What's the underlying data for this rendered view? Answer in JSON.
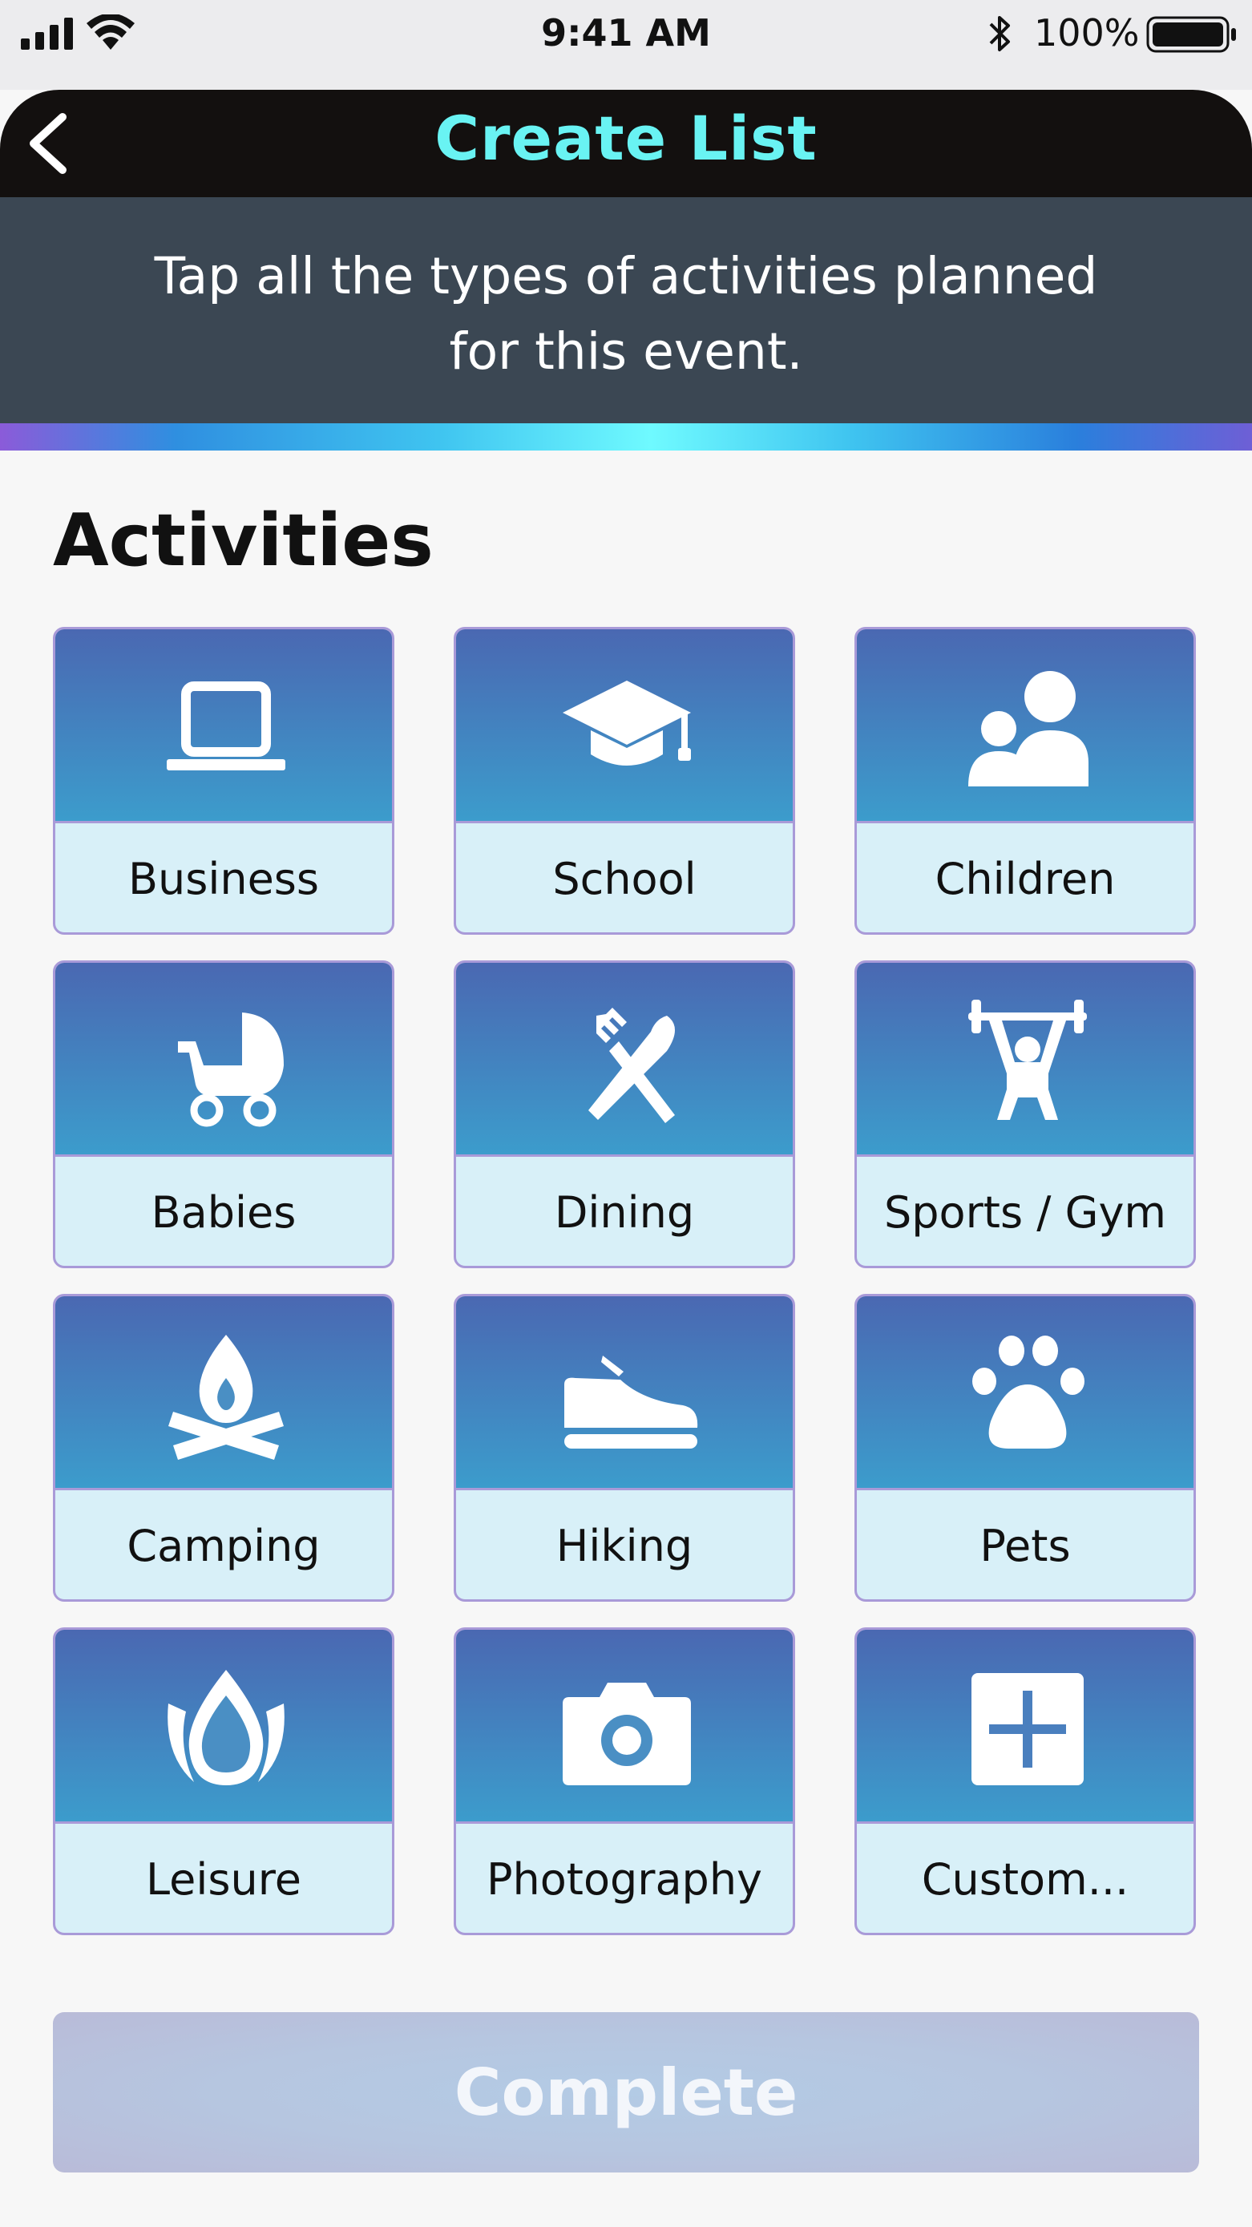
{
  "status_bar": {
    "time": "9:41 AM",
    "battery_percent": "100%",
    "icons": [
      "signal-icon",
      "wifi-icon",
      "bluetooth-icon",
      "battery-icon"
    ]
  },
  "header": {
    "title": "Create List",
    "back_icon": "chevron-left-icon",
    "title_color": "#69f3f3"
  },
  "banner": {
    "instruction": "Tap all the types of activities planned for this event."
  },
  "section": {
    "title": "Activities"
  },
  "activities": [
    {
      "label": "Business",
      "icon": "laptop-icon"
    },
    {
      "label": "School",
      "icon": "graduation-cap-icon"
    },
    {
      "label": "Children",
      "icon": "parent-child-icon"
    },
    {
      "label": "Babies",
      "icon": "stroller-icon"
    },
    {
      "label": "Dining",
      "icon": "fork-knife-icon"
    },
    {
      "label": "Sports / Gym",
      "icon": "weightlifting-icon"
    },
    {
      "label": "Camping",
      "icon": "campfire-icon"
    },
    {
      "label": "Hiking",
      "icon": "shoe-icon"
    },
    {
      "label": "Pets",
      "icon": "paw-icon"
    },
    {
      "label": "Leisure",
      "icon": "lotus-icon"
    },
    {
      "label": "Photography",
      "icon": "camera-icon"
    },
    {
      "label": "Custom...",
      "icon": "plus-square-icon"
    }
  ],
  "footer": {
    "complete_label": "Complete"
  }
}
